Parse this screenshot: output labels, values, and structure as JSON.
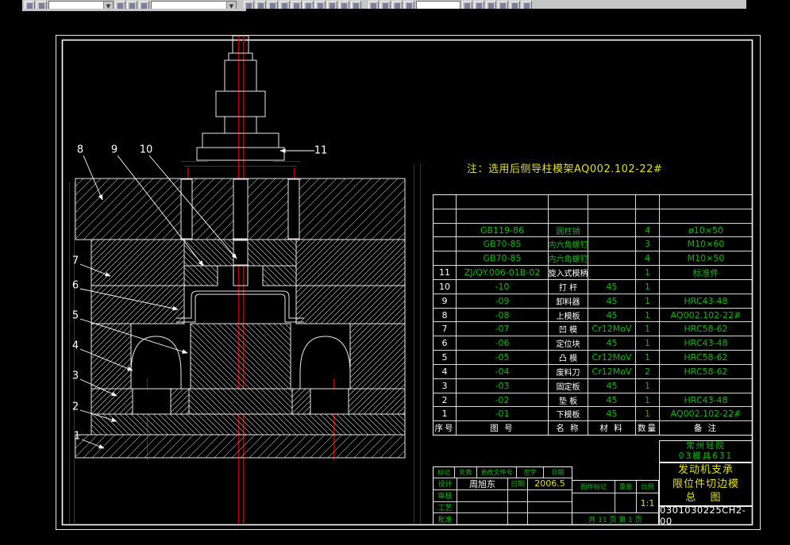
{
  "colors": {
    "green": "#00c000",
    "yellow": "#e4e400",
    "red": "#c00000"
  },
  "toolbar": {
    "combo1": "",
    "combo2": "",
    "field": ""
  },
  "note": "注：选用后侧导柱模架AQ002.102-22#",
  "callouts": [
    "1",
    "2",
    "3",
    "4",
    "5",
    "6",
    "7",
    "8",
    "9",
    "10",
    "11"
  ],
  "parts_table": {
    "header": [
      "序号",
      "图  号",
      "名  称",
      "材  料",
      "数量",
      "备  注"
    ],
    "rows": [
      [
        "",
        "",
        "",
        "",
        "",
        ""
      ],
      [
        "",
        "",
        "",
        "",
        "",
        ""
      ],
      [
        "",
        "GB119-86",
        "圆柱销",
        "",
        "4",
        "ø10×50"
      ],
      [
        "",
        "GB70-85",
        "内六角螺钉",
        "",
        "3",
        "M10×60"
      ],
      [
        "",
        "GB70-85",
        "内六角螺钉",
        "",
        "4",
        "M10×50"
      ],
      [
        "11",
        "ZJ/QY.006-01B-02",
        "旋入式模柄",
        "",
        "1",
        "标准件"
      ],
      [
        "10",
        "-10",
        "打 杆",
        "45",
        "1",
        ""
      ],
      [
        "9",
        "-09",
        "卸料器",
        "45",
        "1",
        "HRC43-48"
      ],
      [
        "8",
        "-08",
        "上模板",
        "45",
        "1",
        "AQ002.102-22#"
      ],
      [
        "7",
        "-07",
        "凹 模",
        "Cr12MoV",
        "1",
        "HRC58-62"
      ],
      [
        "6",
        "-06",
        "定位块",
        "45",
        "1",
        "HRC43-48"
      ],
      [
        "5",
        "-05",
        "凸 模",
        "Cr12MoV",
        "1",
        "HRC58-62"
      ],
      [
        "4",
        "-04",
        "废料刀",
        "Cr12MoV",
        "2",
        "HRC58-62"
      ],
      [
        "3",
        "-03",
        "固定板",
        "45",
        "1",
        ""
      ],
      [
        "2",
        "-02",
        "垫 板",
        "45",
        "1",
        "HRC43-48"
      ],
      [
        "1",
        "-01",
        "下模板",
        "45",
        "1",
        "AQ002.102-22#"
      ]
    ]
  },
  "title_block": {
    "rev_row": [
      "标记",
      "处数",
      "更改文件号",
      "签字",
      "日期"
    ],
    "design_label": "设计",
    "designer": "周旭东",
    "date_label": "日期",
    "date_value": "2006.5",
    "check_label": "审核",
    "process_label": "工艺",
    "approve_label": "批准",
    "mark_header": [
      "图样标记",
      "重量",
      "比例"
    ],
    "scale": "1:1",
    "pages": "共 11 页 第 1 页",
    "school": "常州轻院",
    "class_no": "03模具631",
    "part_line1": "发动机支承",
    "part_line2": "限位件切边模",
    "sheet_label": "总  图",
    "drawing_no": "0301030225CH2-00"
  }
}
